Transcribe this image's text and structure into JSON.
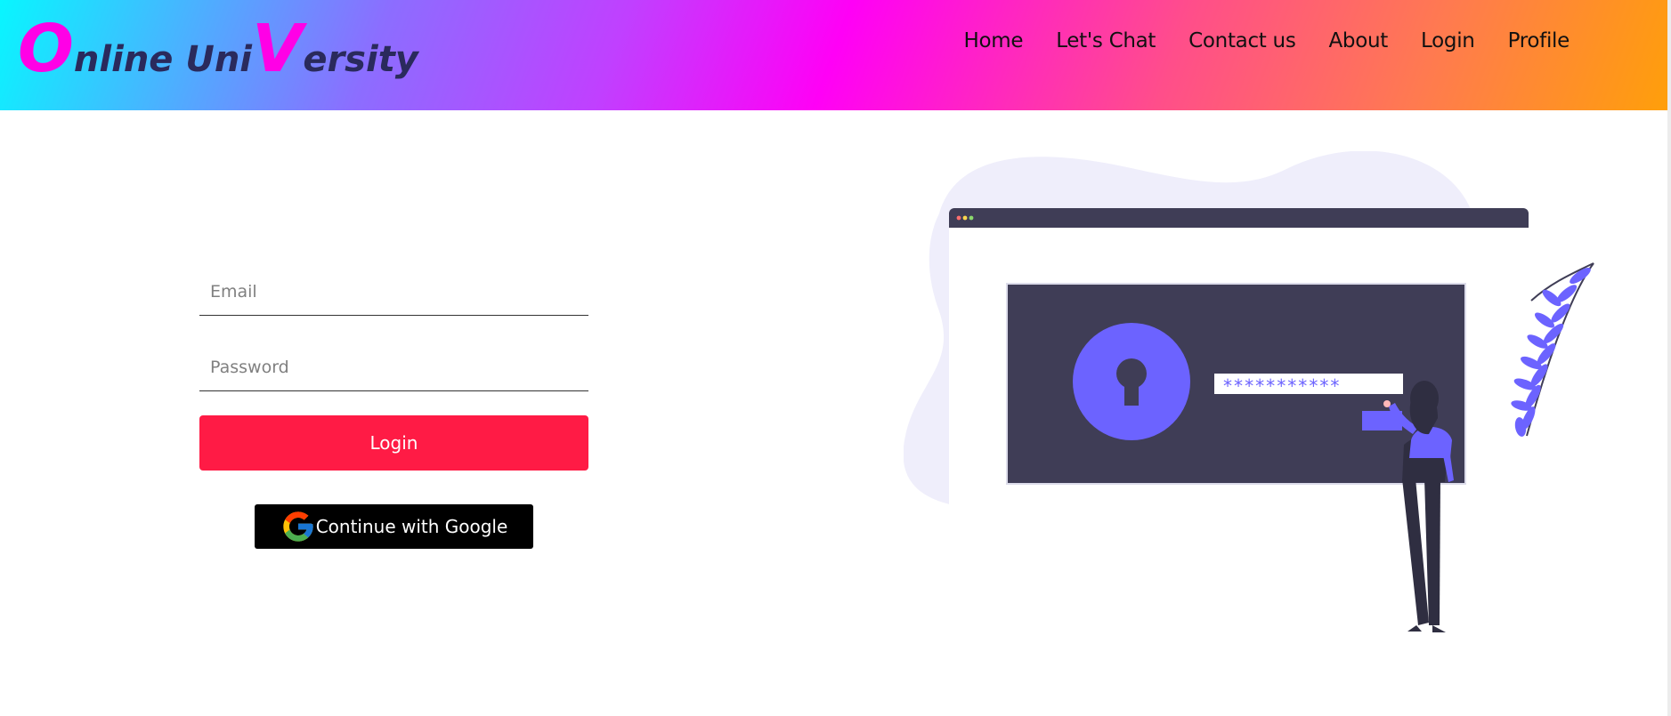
{
  "header": {
    "logo": {
      "first_letter": "O",
      "part1": "nline Uni",
      "second_letter": "V",
      "part2": "ersity"
    },
    "nav": [
      {
        "label": "Home"
      },
      {
        "label": "Let's Chat"
      },
      {
        "label": "Contact us"
      },
      {
        "label": "About"
      },
      {
        "label": "Login"
      },
      {
        "label": "Profile"
      }
    ]
  },
  "login_form": {
    "email_placeholder": "Email",
    "password_placeholder": "Password",
    "login_button": "Login",
    "google_button": "Continue with Google"
  },
  "illustration": {
    "password_mask": "***********"
  },
  "colors": {
    "accent": "#ff1b45",
    "logo_highlight": "#ff00e6",
    "illustration_purple": "#6c63ff",
    "illustration_dark": "#3f3d56"
  },
  "icons": [
    "google-icon",
    "lock-icon",
    "leaf-icon"
  ]
}
